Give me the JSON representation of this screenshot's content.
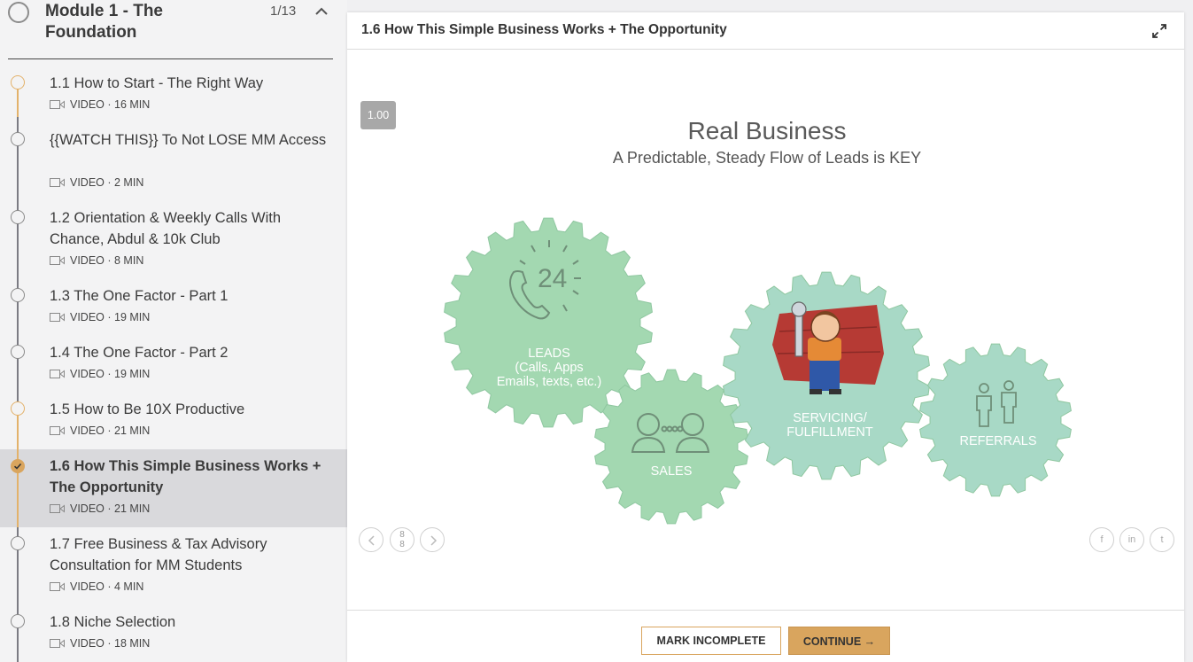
{
  "sidebar": {
    "module": {
      "title": "Module 1 - The Foundation",
      "count": "1/13"
    },
    "lessons": [
      {
        "title": "1.1 How to Start - The Right Way",
        "meta": "VIDEO · 16 MIN",
        "status": "in-progress"
      },
      {
        "title": "{{WATCH THIS}} To Not LOSE MM Access",
        "meta": "VIDEO · 2 MIN",
        "status": "none"
      },
      {
        "title": "1.2 Orientation & Weekly Calls With Chance, Abdul & 10k Club",
        "meta": "VIDEO · 8 MIN",
        "status": "none"
      },
      {
        "title": "1.3 The One Factor - Part 1",
        "meta": "VIDEO · 19 MIN",
        "status": "none"
      },
      {
        "title": "1.4 The One Factor - Part 2",
        "meta": "VIDEO · 19 MIN",
        "status": "none"
      },
      {
        "title": "1.5 How to Be 10X Productive",
        "meta": "VIDEO · 21 MIN",
        "status": "in-progress"
      },
      {
        "title": "1.6 How This Simple Business Works + The Opportunity",
        "meta": "VIDEO · 21 MIN",
        "status": "completed"
      },
      {
        "title": "1.7 Free Business & Tax Advisory Consultation for MM Students",
        "meta": "VIDEO · 4 MIN",
        "status": "none"
      },
      {
        "title": "1.8 Niche Selection",
        "meta": "VIDEO · 18 MIN",
        "status": "none"
      }
    ]
  },
  "main": {
    "title": "1.6 How This Simple Business Works + The Opportunity",
    "speed": "1.00",
    "slide": {
      "title": "Real Business",
      "subtitle": "A Predictable, Steady Flow of Leads is KEY",
      "clock_number": "24",
      "gears": {
        "leads_line1": "LEADS",
        "leads_line2": "(Calls, Apps",
        "leads_line3": "Emails, texts, etc.)",
        "sales": "SALES",
        "servicing_line1": "SERVICING/",
        "servicing_line2": "FULFILLMENT",
        "referrals": "REFERRALS"
      }
    },
    "pagination": {
      "current": "8",
      "total": "8"
    },
    "social": {
      "facebook": "f",
      "linkedin": "in",
      "twitter": "t"
    },
    "footer": {
      "mark_incomplete": "MARK INCOMPLETE",
      "continue": "CONTINUE →"
    }
  },
  "colors": {
    "accent": "#d9a55e",
    "gear_green": "#a3d8b1",
    "gear_teal": "#a8d9c6"
  }
}
